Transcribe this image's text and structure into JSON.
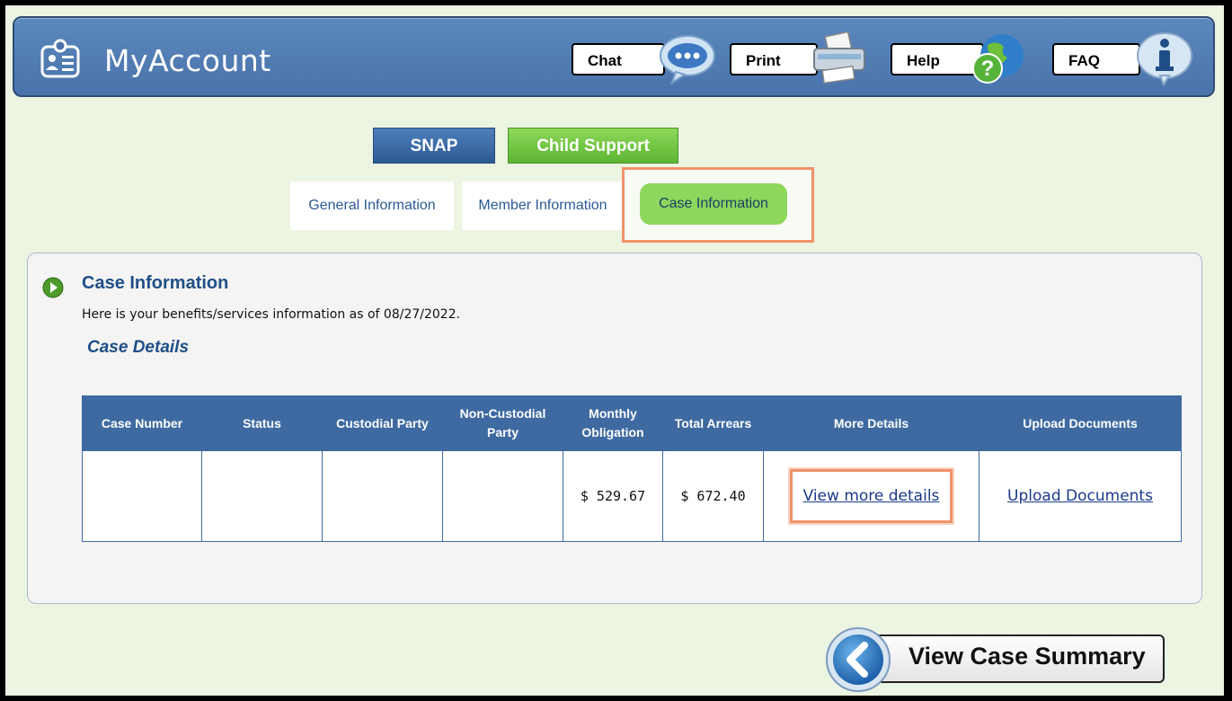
{
  "header": {
    "app_title": "MyAccount",
    "buttons": [
      {
        "label": "Chat",
        "icon": "chat-bubble-icon"
      },
      {
        "label": "Print",
        "icon": "printer-icon"
      },
      {
        "label": "Help",
        "icon": "help-globe-icon"
      },
      {
        "label": "FAQ",
        "icon": "info-icon"
      }
    ]
  },
  "program_tabs": [
    {
      "label": "SNAP",
      "active": false
    },
    {
      "label": "Child Support",
      "active": true
    }
  ],
  "sub_tabs": [
    {
      "label": "General Information",
      "active": false
    },
    {
      "label": "Member Information",
      "active": false
    },
    {
      "label": "Case Information",
      "active": true
    }
  ],
  "section": {
    "title": "Case Information",
    "description": "Here is your benefits/services information as of 08/27/2022.",
    "subheading": "Case Details"
  },
  "table": {
    "headers": [
      "Case Number",
      "Status",
      "Custodial Party",
      "Non-Custodial Party",
      "Monthly Obligation",
      "Total Arrears",
      "More Details",
      "Upload Documents"
    ],
    "rows": [
      {
        "case_number": "",
        "status": "",
        "custodial_party": "",
        "non_custodial_party": "",
        "monthly_obligation": "$ 529.67",
        "total_arrears": "$ 672.40",
        "more_details": "View more details",
        "upload_documents": "Upload Documents"
      }
    ]
  },
  "footer": {
    "view_case_summary": "View Case Summary"
  },
  "colors": {
    "header_blue": "#4a73aa",
    "active_green": "#8cd75c",
    "highlight_orange": "#f0926a",
    "table_header_blue": "#3e6aa1"
  }
}
